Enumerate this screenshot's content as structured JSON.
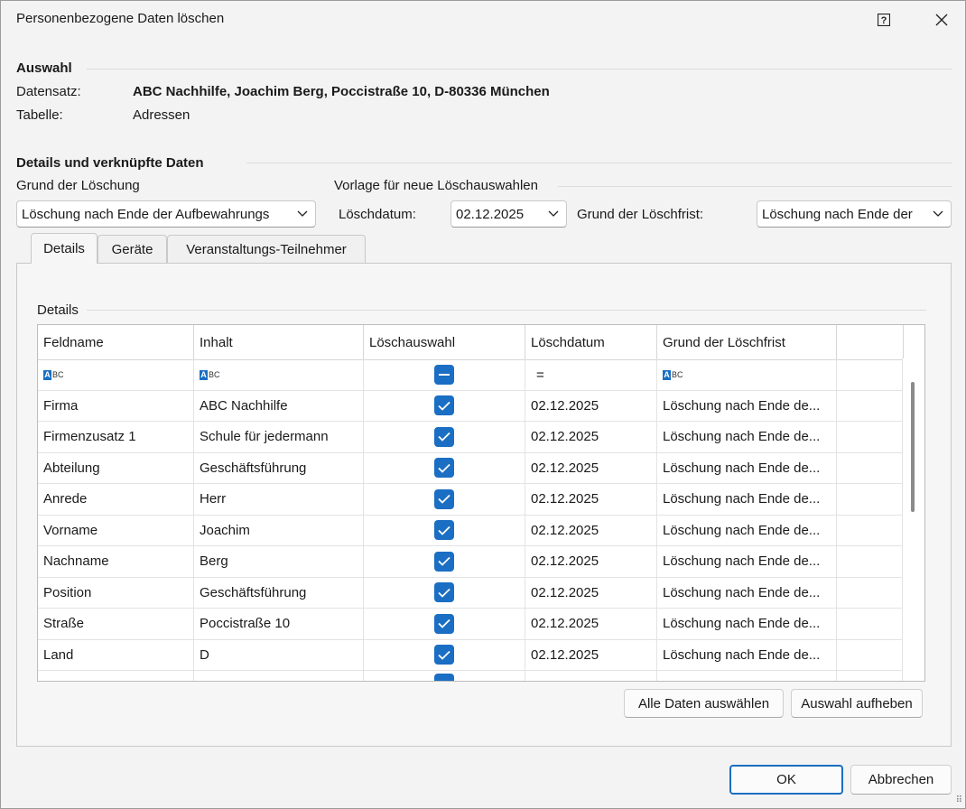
{
  "window": {
    "title": "Personenbezogene Daten löschen",
    "help_icon": "help-icon",
    "close_icon": "close-icon"
  },
  "selection": {
    "section_title": "Auswahl",
    "record_label": "Datensatz:",
    "record_value": "ABC Nachhilfe, Joachim Berg, Poccistraße 10, D-80336 München",
    "table_label": "Tabelle:",
    "table_value": "Adressen"
  },
  "details_section": {
    "title": "Details und verknüpfte Daten",
    "reason_label": "Grund der Löschung",
    "reason_value": "Löschung nach Ende der Aufbewahrungs",
    "template_label": "Vorlage für neue Löschauswahlen",
    "delete_date_label": "Löschdatum:",
    "delete_date_value": "02.12.2025",
    "retention_reason_label": "Grund der Löschfrist:",
    "retention_reason_value": "Löschung nach Ende der"
  },
  "tabs": [
    {
      "label": "Details",
      "active": true
    },
    {
      "label": "Geräte",
      "active": false
    },
    {
      "label": "Veranstaltungs-Teilnehmer",
      "active": false
    }
  ],
  "grid": {
    "group_label": "Details",
    "columns": [
      "Feldname",
      "Inhalt",
      "Löschauswahl",
      "Löschdatum",
      "Grund der Löschfrist"
    ],
    "filter_row": {
      "text_filter_icon": "abc-filter-icon",
      "equals_symbol": "="
    },
    "rows": [
      {
        "field": "Firma",
        "content": "ABC Nachhilfe",
        "checked": true,
        "date": "02.12.2025",
        "reason": "Löschung nach Ende de..."
      },
      {
        "field": "Firmenzusatz 1",
        "content": "Schule für jedermann",
        "checked": true,
        "date": "02.12.2025",
        "reason": "Löschung nach Ende de..."
      },
      {
        "field": "Abteilung",
        "content": "Geschäftsführung",
        "checked": true,
        "date": "02.12.2025",
        "reason": "Löschung nach Ende de..."
      },
      {
        "field": "Anrede",
        "content": "Herr",
        "checked": true,
        "date": "02.12.2025",
        "reason": "Löschung nach Ende de..."
      },
      {
        "field": "Vorname",
        "content": "Joachim",
        "checked": true,
        "date": "02.12.2025",
        "reason": "Löschung nach Ende de..."
      },
      {
        "field": "Nachname",
        "content": "Berg",
        "checked": true,
        "date": "02.12.2025",
        "reason": "Löschung nach Ende de..."
      },
      {
        "field": "Position",
        "content": "Geschäftsführung",
        "checked": true,
        "date": "02.12.2025",
        "reason": "Löschung nach Ende de..."
      },
      {
        "field": "Straße",
        "content": "Poccistraße 10",
        "checked": true,
        "date": "02.12.2025",
        "reason": "Löschung nach Ende de..."
      },
      {
        "field": "Land",
        "content": "D",
        "checked": true,
        "date": "02.12.2025",
        "reason": "Löschung nach Ende de..."
      }
    ]
  },
  "buttons": {
    "select_all": "Alle Daten auswählen",
    "clear_selection": "Auswahl aufheben",
    "ok": "OK",
    "cancel": "Abbrechen"
  },
  "colors": {
    "accent": "#1a6ec3",
    "background": "#f3f3f3"
  }
}
